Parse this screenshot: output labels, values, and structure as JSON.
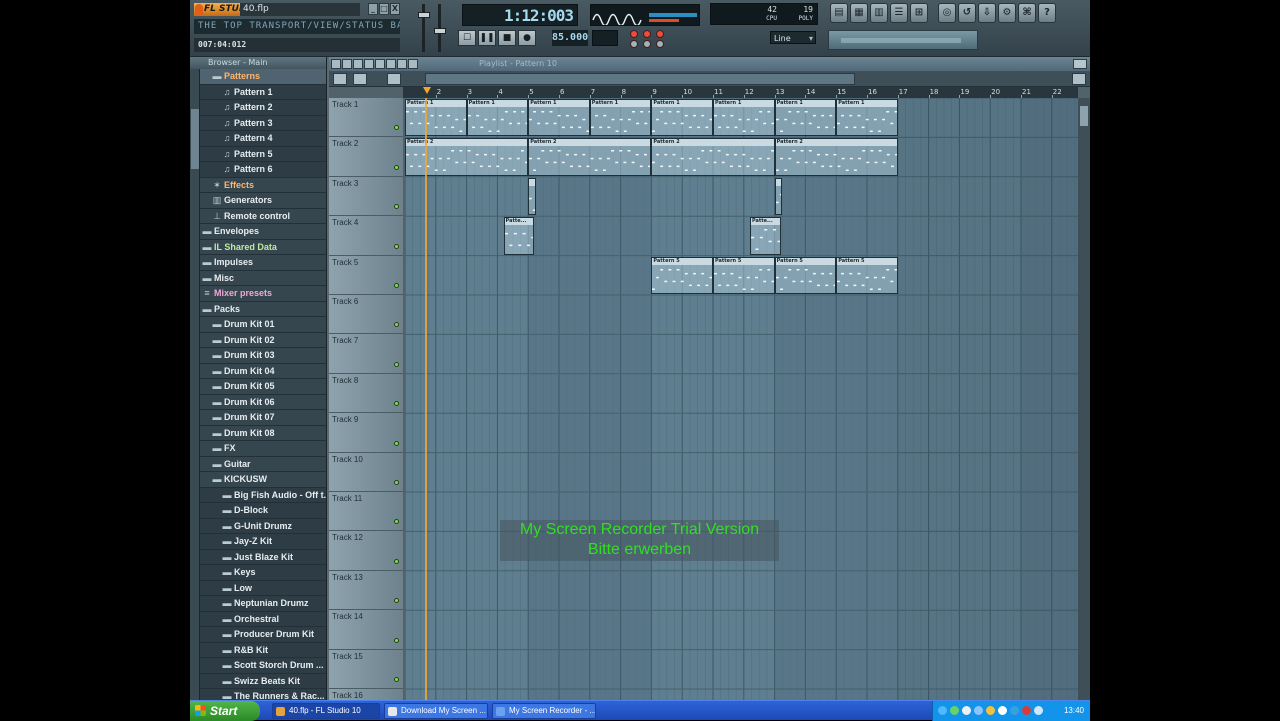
{
  "app": {
    "logo": "FL STUDIO",
    "filename": "40.flp",
    "hint": "THE TOP TRANSPORT/VIEW/STATUS BAR...",
    "timestamp": "007:04:012",
    "song_time": "1:12:003",
    "tempo": "85.000",
    "snap": "Line",
    "monitor_a": "42",
    "monitor_b": "19",
    "monitor_cpu": "CPU",
    "monitor_poly": "POLY"
  },
  "transport": {
    "pause": "❚❚",
    "stop": "■",
    "record": "●"
  },
  "window_buttons": [
    "_",
    "□",
    "X"
  ],
  "browser": {
    "header": "Browser - Main",
    "items": [
      {
        "label": "Patterns",
        "depth": 0,
        "icon": "folder-icon",
        "glyph": "▬",
        "style": "orange",
        "sel": true
      },
      {
        "label": "Pattern 1",
        "depth": 1,
        "icon": "note-icon",
        "glyph": "♫",
        "style": ""
      },
      {
        "label": "Pattern 2",
        "depth": 1,
        "icon": "note-icon",
        "glyph": "♫",
        "style": ""
      },
      {
        "label": "Pattern 3",
        "depth": 1,
        "icon": "note-icon",
        "glyph": "♫",
        "style": ""
      },
      {
        "label": "Pattern 4",
        "depth": 1,
        "icon": "note-icon",
        "glyph": "♫",
        "style": ""
      },
      {
        "label": "Pattern 5",
        "depth": 1,
        "icon": "note-icon",
        "glyph": "♫",
        "style": ""
      },
      {
        "label": "Pattern 6",
        "depth": 1,
        "icon": "note-icon",
        "glyph": "♫",
        "style": ""
      },
      {
        "label": "Effects",
        "depth": 0,
        "icon": "effects-icon",
        "glyph": "✶",
        "style": "orange"
      },
      {
        "label": "Generators",
        "depth": 0,
        "icon": "generators-icon",
        "glyph": "▥",
        "style": ""
      },
      {
        "label": "Remote control",
        "depth": 0,
        "icon": "remote-icon",
        "glyph": "⊥",
        "style": ""
      },
      {
        "label": "Envelopes",
        "depth": -1,
        "icon": "folder-icon",
        "glyph": "▬",
        "style": ""
      },
      {
        "label": "IL Shared Data",
        "depth": -1,
        "icon": "folder-icon",
        "glyph": "▬",
        "style": "green"
      },
      {
        "label": "Impulses",
        "depth": -1,
        "icon": "folder-icon",
        "glyph": "▬",
        "style": ""
      },
      {
        "label": "Misc",
        "depth": -1,
        "icon": "folder-icon",
        "glyph": "▬",
        "style": ""
      },
      {
        "label": "Mixer presets",
        "depth": -1,
        "icon": "mixer-icon",
        "glyph": "≡",
        "style": "pink"
      },
      {
        "label": "Packs",
        "depth": -1,
        "icon": "folder-icon",
        "glyph": "▬",
        "style": ""
      },
      {
        "label": "Drum Kit 01",
        "depth": 0,
        "icon": "folder-icon",
        "glyph": "▬",
        "style": ""
      },
      {
        "label": "Drum Kit 02",
        "depth": 0,
        "icon": "folder-icon",
        "glyph": "▬",
        "style": ""
      },
      {
        "label": "Drum Kit 03",
        "depth": 0,
        "icon": "folder-icon",
        "glyph": "▬",
        "style": ""
      },
      {
        "label": "Drum Kit 04",
        "depth": 0,
        "icon": "folder-icon",
        "glyph": "▬",
        "style": ""
      },
      {
        "label": "Drum Kit 05",
        "depth": 0,
        "icon": "folder-icon",
        "glyph": "▬",
        "style": ""
      },
      {
        "label": "Drum Kit 06",
        "depth": 0,
        "icon": "folder-icon",
        "glyph": "▬",
        "style": ""
      },
      {
        "label": "Drum Kit 07",
        "depth": 0,
        "icon": "folder-icon",
        "glyph": "▬",
        "style": ""
      },
      {
        "label": "Drum Kit 08",
        "depth": 0,
        "icon": "folder-icon",
        "glyph": "▬",
        "style": ""
      },
      {
        "label": "FX",
        "depth": 0,
        "icon": "folder-icon",
        "glyph": "▬",
        "style": ""
      },
      {
        "label": "Guitar",
        "depth": 0,
        "icon": "folder-icon",
        "glyph": "▬",
        "style": ""
      },
      {
        "label": "KICKUSW",
        "depth": 0,
        "icon": "folder-icon",
        "glyph": "▬",
        "style": ""
      },
      {
        "label": "Big Fish Audio - Off t...",
        "depth": 1,
        "icon": "folder-icon",
        "glyph": "▬",
        "style": ""
      },
      {
        "label": "D-Block",
        "depth": 1,
        "icon": "folder-icon",
        "glyph": "▬",
        "style": ""
      },
      {
        "label": "G-Unit Drumz",
        "depth": 1,
        "icon": "folder-icon",
        "glyph": "▬",
        "style": ""
      },
      {
        "label": "Jay-Z Kit",
        "depth": 1,
        "icon": "folder-icon",
        "glyph": "▬",
        "style": ""
      },
      {
        "label": "Just Blaze Kit",
        "depth": 1,
        "icon": "folder-icon",
        "glyph": "▬",
        "style": ""
      },
      {
        "label": "Keys",
        "depth": 1,
        "icon": "folder-icon",
        "glyph": "▬",
        "style": ""
      },
      {
        "label": "Low",
        "depth": 1,
        "icon": "folder-icon",
        "glyph": "▬",
        "style": ""
      },
      {
        "label": "Neptunian Drumz",
        "depth": 1,
        "icon": "folder-icon",
        "glyph": "▬",
        "style": ""
      },
      {
        "label": "Orchestral",
        "depth": 1,
        "icon": "folder-icon",
        "glyph": "▬",
        "style": ""
      },
      {
        "label": "Producer Drum Kit",
        "depth": 1,
        "icon": "folder-icon",
        "glyph": "▬",
        "style": ""
      },
      {
        "label": "R&B Kit",
        "depth": 1,
        "icon": "folder-icon",
        "glyph": "▬",
        "style": ""
      },
      {
        "label": "Scott Storch Drum ...",
        "depth": 1,
        "icon": "folder-icon",
        "glyph": "▬",
        "style": ""
      },
      {
        "label": "Swizz Beats Kit",
        "depth": 1,
        "icon": "folder-icon",
        "glyph": "▬",
        "style": ""
      },
      {
        "label": "The Runners & Rac...",
        "depth": 1,
        "icon": "folder-icon",
        "glyph": "▬",
        "style": ""
      }
    ]
  },
  "playlist": {
    "title": "Playlist - Pattern 10",
    "ruler": [
      "2",
      "3",
      "4",
      "5",
      "6",
      "7",
      "8",
      "9",
      "10",
      "11",
      "12",
      "13",
      "14",
      "15",
      "16",
      "17",
      "18",
      "19",
      "20",
      "21",
      "22"
    ],
    "tracks": [
      "Track 1",
      "Track 2",
      "Track 3",
      "Track 4",
      "Track 5",
      "Track 6",
      "Track 7",
      "Track 8",
      "Track 9",
      "Track 10",
      "Track 11",
      "Track 12",
      "Track 13",
      "Track 14",
      "Track 15",
      "Track 16"
    ],
    "clips": [
      {
        "track": 0,
        "start": 1,
        "len": 2,
        "label": "Pattern 1"
      },
      {
        "track": 0,
        "start": 3,
        "len": 2,
        "label": "Pattern 1"
      },
      {
        "track": 0,
        "start": 5,
        "len": 2,
        "label": "Pattern 1"
      },
      {
        "track": 0,
        "start": 7,
        "len": 2,
        "label": "Pattern 1"
      },
      {
        "track": 0,
        "start": 9,
        "len": 2,
        "label": "Pattern 1"
      },
      {
        "track": 0,
        "start": 11,
        "len": 2,
        "label": "Pattern 1"
      },
      {
        "track": 0,
        "start": 13,
        "len": 2,
        "label": "Pattern 1"
      },
      {
        "track": 0,
        "start": 15,
        "len": 2,
        "label": "Pattern 1"
      },
      {
        "track": 1,
        "start": 1,
        "len": 4,
        "label": "Pattern 2"
      },
      {
        "track": 1,
        "start": 5,
        "len": 4,
        "label": "Pattern 2"
      },
      {
        "track": 1,
        "start": 9,
        "len": 4,
        "label": "Pattern 2"
      },
      {
        "track": 1,
        "start": 13,
        "len": 4,
        "label": "Pattern 2"
      },
      {
        "track": 2,
        "start": 5,
        "len": 0.25,
        "label": ""
      },
      {
        "track": 2,
        "start": 13,
        "len": 0.25,
        "label": ""
      },
      {
        "track": 3,
        "start": 4.2,
        "len": 1,
        "label": "Patte..."
      },
      {
        "track": 3,
        "start": 12.2,
        "len": 1,
        "label": "Patte..."
      },
      {
        "track": 4,
        "start": 9,
        "len": 2,
        "label": "Pattern 5"
      },
      {
        "track": 4,
        "start": 11,
        "len": 2,
        "label": "Pattern 5"
      },
      {
        "track": 4,
        "start": 13,
        "len": 2,
        "label": "Pattern 5"
      },
      {
        "track": 4,
        "start": 15,
        "len": 2,
        "label": "Pattern 5"
      }
    ],
    "playhead": 1.7,
    "song_end": 17
  },
  "watermark": {
    "line1": "My Screen Recorder Trial Version",
    "line2": "Bitte erwerben"
  },
  "taskbar": {
    "start": "Start",
    "tasks": [
      "40.flp - FL Studio 10",
      "Download My Screen ...",
      "My Screen Recorder - ..."
    ],
    "clock": "13:40"
  }
}
